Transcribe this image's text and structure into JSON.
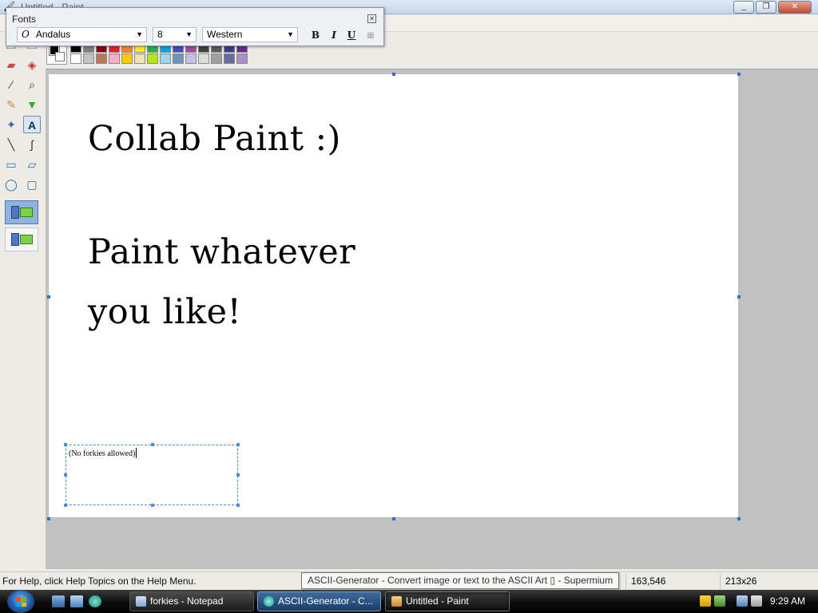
{
  "window": {
    "title": "Untitled - Paint",
    "minimize_glyph": "_",
    "maximize_glyph": "❐",
    "close_glyph": "✕"
  },
  "fonts_toolbar": {
    "title": "Fonts",
    "close_glyph": "✕",
    "font_glyph": "O",
    "font_name": "Andalus",
    "font_size": "8",
    "script": "Western",
    "bold_label": "B",
    "italic_label": "I",
    "underline_label": "U",
    "dropdown_glyph": "▼"
  },
  "canvas": {
    "line1": "Collab Paint :)",
    "line2": "Paint whatever",
    "line3": "you like!",
    "textbox_text": "(No forkies allowed)"
  },
  "palette": {
    "row1": [
      "#000000",
      "#7f7f7f",
      "#880015",
      "#ed1c24",
      "#ff7f27",
      "#fff200",
      "#22b14c",
      "#00a2e8",
      "#3f48cc",
      "#a349a4",
      "#404040",
      "#5a5a5a",
      "#3a3a8a",
      "#6a2a8a"
    ],
    "row2": [
      "#ffffff",
      "#c3c3c3",
      "#b97a57",
      "#ffaec9",
      "#ffc90e",
      "#efe4b0",
      "#b5e61d",
      "#99d9ea",
      "#7092be",
      "#c8bfe7",
      "#dcdcdc",
      "#a0a0a0",
      "#6a6a9a",
      "#a890c8"
    ]
  },
  "statusbar": {
    "help": "For Help, click Help Topics on the Help Menu.",
    "coords": "163,546",
    "size": "213x26"
  },
  "tooltip": "ASCII-Generator - Convert image or text to the ASCII Art ▯ - Supermium",
  "taskbar": {
    "buttons": [
      {
        "label": "forkies - Notepad"
      },
      {
        "label": "ASCII-Generator - C..."
      },
      {
        "label": "Untitled - Paint"
      }
    ],
    "clock": "9:29 AM"
  },
  "colors": {
    "accent": "#2f6fd4",
    "taskbar": "#0c0c0c"
  }
}
